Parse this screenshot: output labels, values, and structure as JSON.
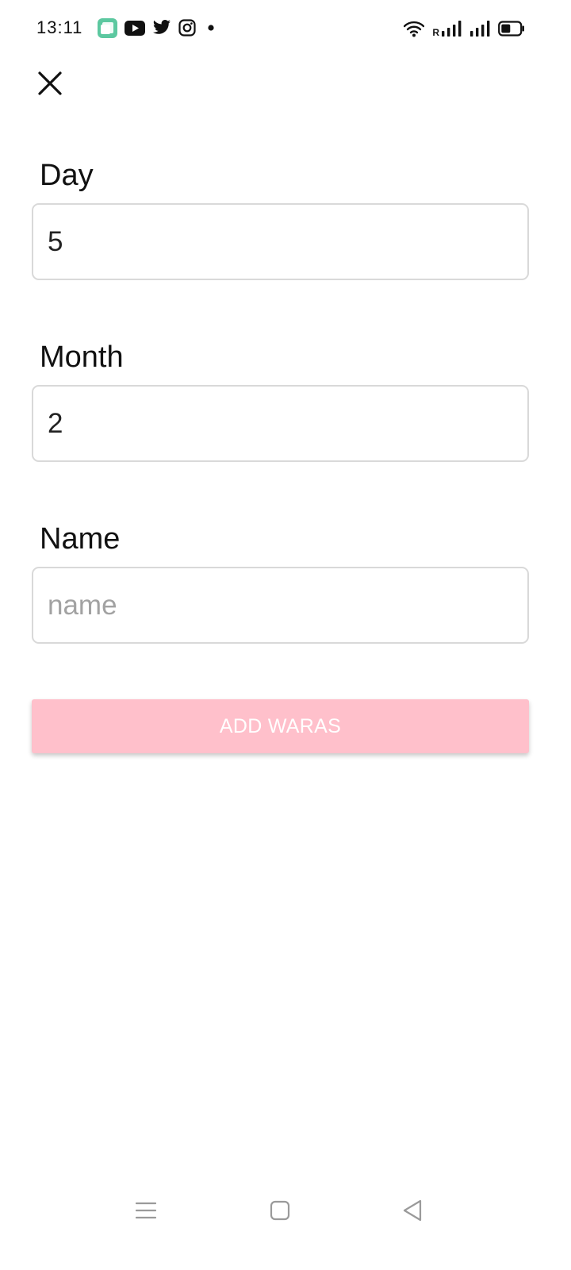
{
  "status_bar": {
    "time": "13:11",
    "roaming_indicator": "R",
    "notification_icons": [
      "app-notification-icon",
      "youtube-icon",
      "twitter-icon",
      "instagram-icon",
      "more-dot-icon"
    ],
    "system_icons": [
      "wifi-icon",
      "signal-icon",
      "signal-icon",
      "battery-icon"
    ],
    "battery_level": 0.5
  },
  "toolbar": {
    "close_icon": "close-icon"
  },
  "form": {
    "day": {
      "label": "Day",
      "value": "5",
      "placeholder": ""
    },
    "month": {
      "label": "Month",
      "value": "2",
      "placeholder": ""
    },
    "name": {
      "label": "Name",
      "value": "",
      "placeholder": "name"
    },
    "submit_label": "ADD WARAS"
  },
  "nav_bar": {
    "buttons": [
      "menu-icon",
      "home-icon",
      "back-icon"
    ]
  },
  "colors": {
    "accent": "#ffc0cb",
    "button_text": "#ffffff",
    "input_border": "#d9d9d9",
    "placeholder": "#a2a2a2"
  }
}
